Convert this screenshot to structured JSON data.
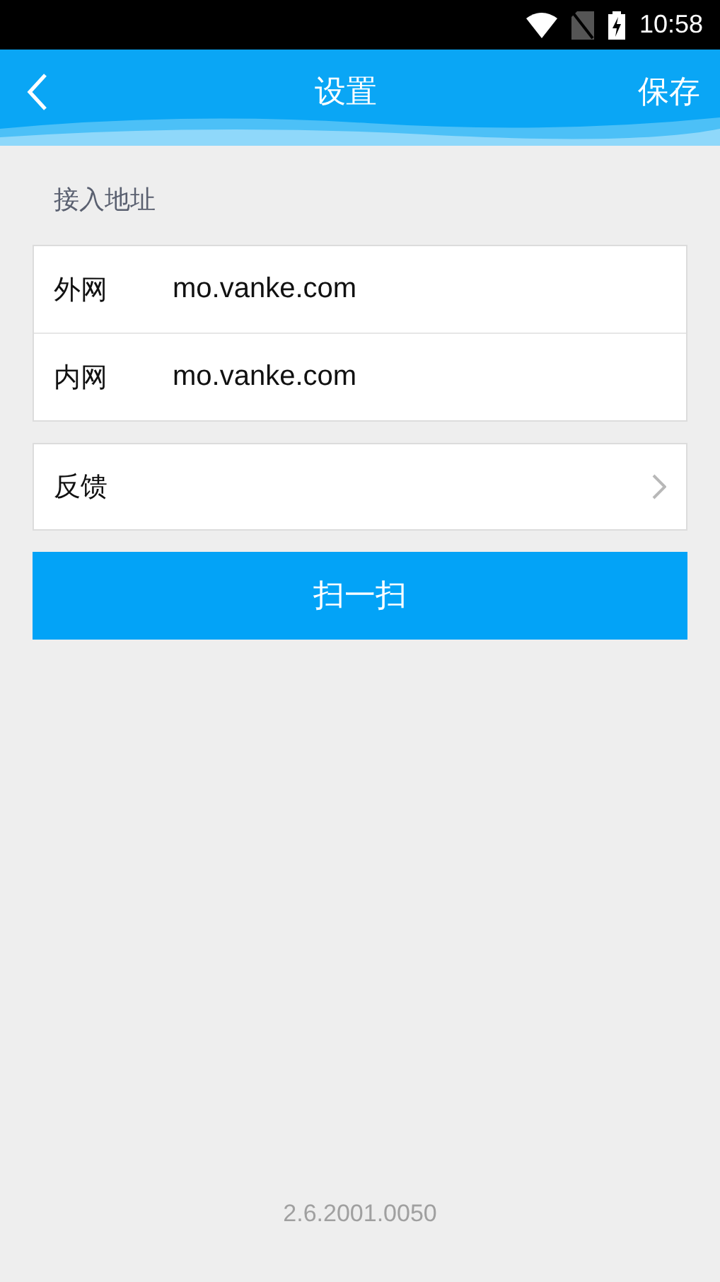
{
  "status_bar": {
    "time": "10:58"
  },
  "header": {
    "title": "设置",
    "action": "保存"
  },
  "section_label": "接入地址",
  "address_fields": [
    {
      "label": "外网",
      "value": "mo.vanke.com"
    },
    {
      "label": "内网",
      "value": "mo.vanke.com"
    }
  ],
  "feedback": {
    "label": "反馈"
  },
  "scan_button": "扫一扫",
  "version": "2.6.2001.0050"
}
